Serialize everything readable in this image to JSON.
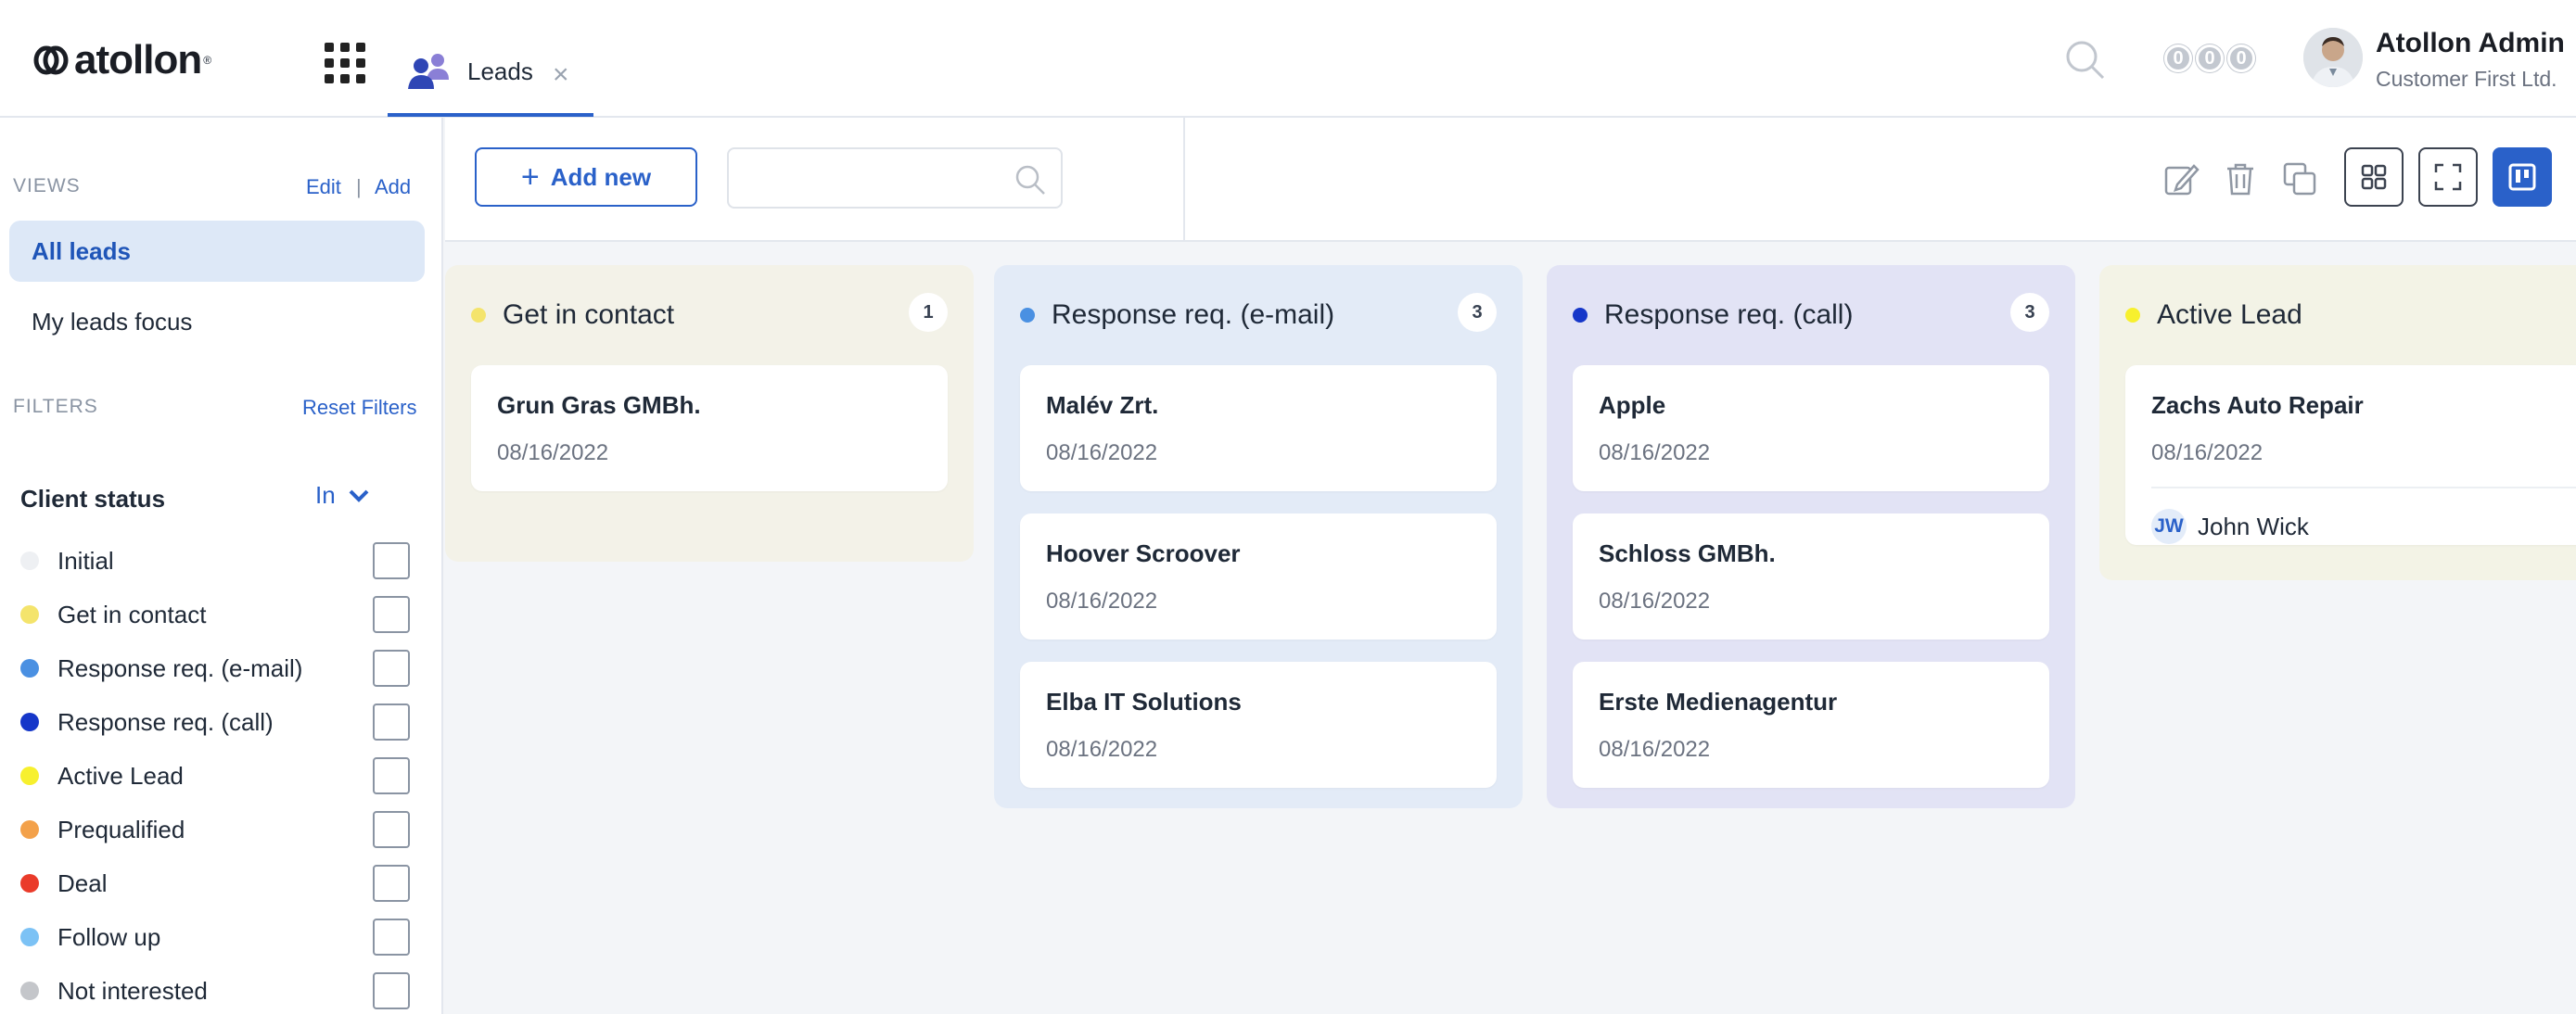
{
  "header": {
    "logo_text": "atollon",
    "logo_mark": "®",
    "tab_label": "Leads",
    "tab_close": "×",
    "counters": [
      "0",
      "0",
      "0"
    ],
    "user_name": "Atollon Admin",
    "user_company": "Customer First Ltd."
  },
  "sidebar": {
    "views_label": "VIEWS",
    "edit_label": "Edit",
    "separator": "|",
    "add_label": "Add",
    "views": [
      "All leads",
      "My leads focus"
    ],
    "filters_label": "FILTERS",
    "reset_label": "Reset Filters",
    "client_status_label": "Client status",
    "in_label": "In",
    "statuses": [
      {
        "label": "Initial",
        "color": "#eef0f3"
      },
      {
        "label": "Get in contact",
        "color": "#f4e46c"
      },
      {
        "label": "Response req. (e-mail)",
        "color": "#4a90e2"
      },
      {
        "label": "Response req. (call)",
        "color": "#1637c9"
      },
      {
        "label": "Active Lead",
        "color": "#f7f02e"
      },
      {
        "label": "Prequalified",
        "color": "#f3a14a"
      },
      {
        "label": "Deal",
        "color": "#ea3b2a"
      },
      {
        "label": "Follow up",
        "color": "#7cc2f5"
      },
      {
        "label": "Not interested",
        "color": "#c4c6ca"
      }
    ]
  },
  "toolbar": {
    "add_plus": "+",
    "add_label": "Add new",
    "search_placeholder": ""
  },
  "board": {
    "columns": [
      {
        "title": "Get in contact",
        "count": "1",
        "dot": "#f4e46c",
        "bg": "#f3f2e8",
        "cards": [
          {
            "name": "Grun Gras GMBh.",
            "date": "08/16/2022"
          }
        ]
      },
      {
        "title": "Response req. (e-mail)",
        "count": "3",
        "dot": "#4a90e2",
        "bg": "#e3ebf7",
        "cards": [
          {
            "name": "Malév Zrt.",
            "date": "08/16/2022"
          },
          {
            "name": "Hoover Scroover",
            "date": "08/16/2022"
          },
          {
            "name": "Elba IT Solutions",
            "date": "08/16/2022"
          }
        ]
      },
      {
        "title": "Response req. (call)",
        "count": "3",
        "dot": "#1637c9",
        "bg": "#e2e3f5",
        "cards": [
          {
            "name": "Apple",
            "date": "08/16/2022"
          },
          {
            "name": "Schloss GMBh.",
            "date": "08/16/2022"
          },
          {
            "name": "Erste Medienagentur",
            "date": "08/16/2022"
          }
        ]
      },
      {
        "title": "Active Lead",
        "count": "",
        "dot": "#f7f02e",
        "bg": "#f3f3e6",
        "cards": [
          {
            "name": "Zachs Auto Repair",
            "date": "08/16/2022",
            "assignee_initials": "JW",
            "assignee_name": "John Wick"
          }
        ]
      }
    ]
  }
}
